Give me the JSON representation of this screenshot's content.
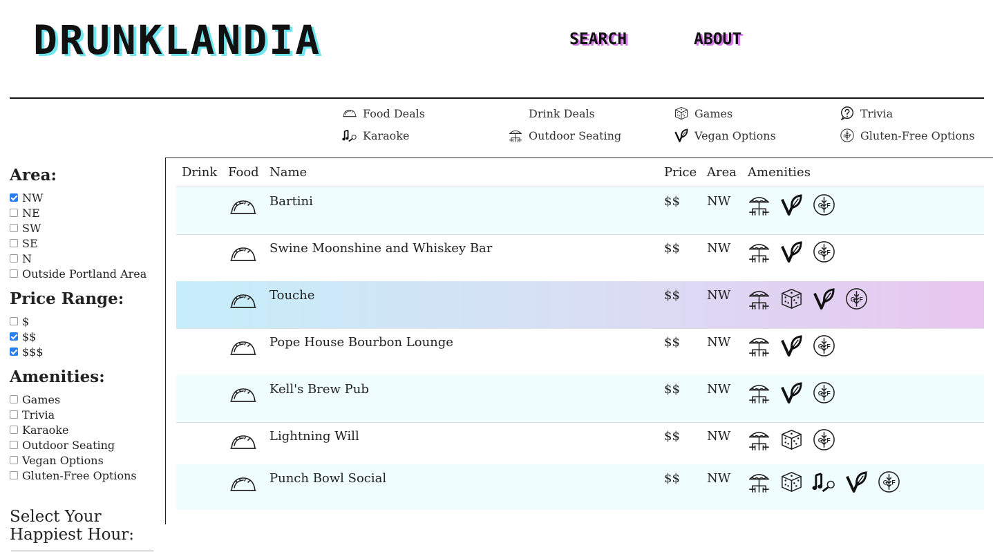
{
  "header": {
    "logo": "DRUNKLANDIA",
    "nav": [
      {
        "label": "SEARCH"
      },
      {
        "label": "ABOUT"
      }
    ]
  },
  "legend": [
    {
      "label": "Food Deals",
      "icon": "taco-icon"
    },
    {
      "label": "Drink Deals",
      "icon": ""
    },
    {
      "label": "Games",
      "icon": "dice-icon"
    },
    {
      "label": "Trivia",
      "icon": "question-icon"
    },
    {
      "label": "Karaoke",
      "icon": "karaoke-icon"
    },
    {
      "label": "Outdoor Seating",
      "icon": "umbrella-table-icon"
    },
    {
      "label": "Vegan Options",
      "icon": "vegan-icon"
    },
    {
      "label": "Gluten-Free Options",
      "icon": "gluten-free-icon"
    }
  ],
  "sidebar": {
    "area_title": "Area:",
    "areas": [
      {
        "label": "NW",
        "checked": true
      },
      {
        "label": "NE",
        "checked": false
      },
      {
        "label": "SW",
        "checked": false
      },
      {
        "label": "SE",
        "checked": false
      },
      {
        "label": "N",
        "checked": false
      },
      {
        "label": "Outside Portland Area",
        "checked": false
      }
    ],
    "price_title": "Price Range:",
    "prices": [
      {
        "label": "$",
        "checked": false
      },
      {
        "label": "$$",
        "checked": true
      },
      {
        "label": "$$$",
        "checked": true
      }
    ],
    "amenities_title": "Amenities:",
    "amenities": [
      {
        "label": "Games",
        "checked": false
      },
      {
        "label": "Trivia",
        "checked": false
      },
      {
        "label": "Karaoke",
        "checked": false
      },
      {
        "label": "Outdoor Seating",
        "checked": false
      },
      {
        "label": "Vegan Options",
        "checked": false
      },
      {
        "label": "Gluten-Free Options",
        "checked": false
      }
    ],
    "happy_title": "Select Your Happiest Hour:"
  },
  "table": {
    "headers": {
      "drink": "Drink",
      "food": "Food",
      "name": "Name",
      "price": "Price",
      "area": "Area",
      "amenities": "Amenities"
    },
    "rows": [
      {
        "name": "Bartini",
        "price": "$$",
        "area": "NW",
        "food": true,
        "amenities": [
          "umbrella-table-icon",
          "vegan-icon",
          "gluten-free-icon"
        ]
      },
      {
        "name": "Swine Moonshine and Whiskey Bar",
        "price": "$$",
        "area": "NW",
        "food": true,
        "amenities": [
          "umbrella-table-icon",
          "vegan-icon",
          "gluten-free-icon"
        ]
      },
      {
        "name": "Touche",
        "price": "$$",
        "area": "NW",
        "food": true,
        "amenities": [
          "umbrella-table-icon",
          "dice-icon",
          "vegan-icon",
          "gluten-free-icon"
        ]
      },
      {
        "name": "Pope House Bourbon Lounge",
        "price": "$$",
        "area": "NW",
        "food": true,
        "amenities": [
          "umbrella-table-icon",
          "vegan-icon",
          "gluten-free-icon"
        ]
      },
      {
        "name": "Kell's Brew Pub",
        "price": "$$",
        "area": "NW",
        "food": true,
        "amenities": [
          "umbrella-table-icon",
          "vegan-icon",
          "gluten-free-icon"
        ]
      },
      {
        "name": "Lightning Will",
        "price": "$$",
        "area": "NW",
        "food": true,
        "amenities": [
          "umbrella-table-icon",
          "dice-icon",
          "gluten-free-icon"
        ]
      },
      {
        "name": "Punch Bowl Social",
        "price": "$$",
        "area": "NW",
        "food": true,
        "amenities": [
          "umbrella-table-icon",
          "dice-icon",
          "karaoke-icon",
          "vegan-icon",
          "gluten-free-icon"
        ]
      }
    ]
  },
  "colors": {
    "logo_shadow": "#6fe6f0",
    "nav_shadow": "#d47de8",
    "row_alt": "#f0fdff",
    "highlight_start": "#c6eefa",
    "highlight_end": "#e9c6f0"
  }
}
